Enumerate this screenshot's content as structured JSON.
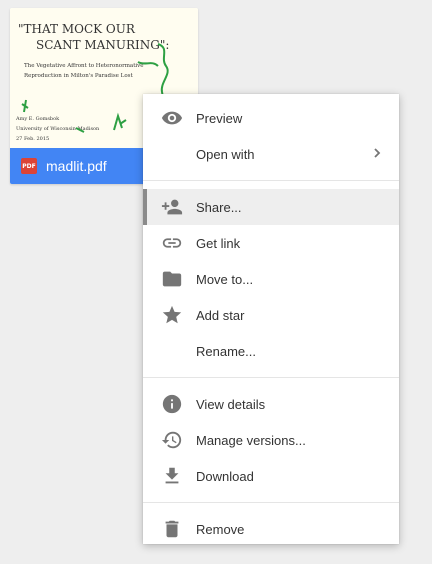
{
  "file": {
    "name": "madlit.pdf",
    "type_badge": "PDF",
    "thumbnail": {
      "title_line1": "\"THAT MOCK OUR",
      "title_line2": "SCANT MANURING\":",
      "subtitle_line1": "The Vegetative Affront to Heteronormative",
      "subtitle_line2": "Reproduction in Milton's Paradise Lost",
      "author": "Amy E. Gomsbok",
      "affiliation": "University of Wisconsin-Madison",
      "date": "27 Feb. 2015"
    }
  },
  "menu": {
    "groups": [
      [
        {
          "label": "Preview",
          "icon": "eye-icon"
        },
        {
          "label": "Open with",
          "icon": "",
          "submenu": true
        }
      ],
      [
        {
          "label": "Share...",
          "icon": "person-add-icon",
          "active": true
        },
        {
          "label": "Get link",
          "icon": "link-icon"
        },
        {
          "label": "Move to...",
          "icon": "folder-icon"
        },
        {
          "label": "Add star",
          "icon": "star-icon"
        },
        {
          "label": "Rename...",
          "icon": ""
        }
      ],
      [
        {
          "label": "View details",
          "icon": "info-icon"
        },
        {
          "label": "Manage versions...",
          "icon": "history-icon"
        },
        {
          "label": "Download",
          "icon": "download-icon"
        }
      ],
      [
        {
          "label": "Remove",
          "icon": "trash-icon"
        }
      ]
    ]
  },
  "colors": {
    "file_bar": "#4285f4",
    "pdf_badge": "#db4437",
    "icon": "#757575",
    "active_row": "#eeeeee"
  }
}
